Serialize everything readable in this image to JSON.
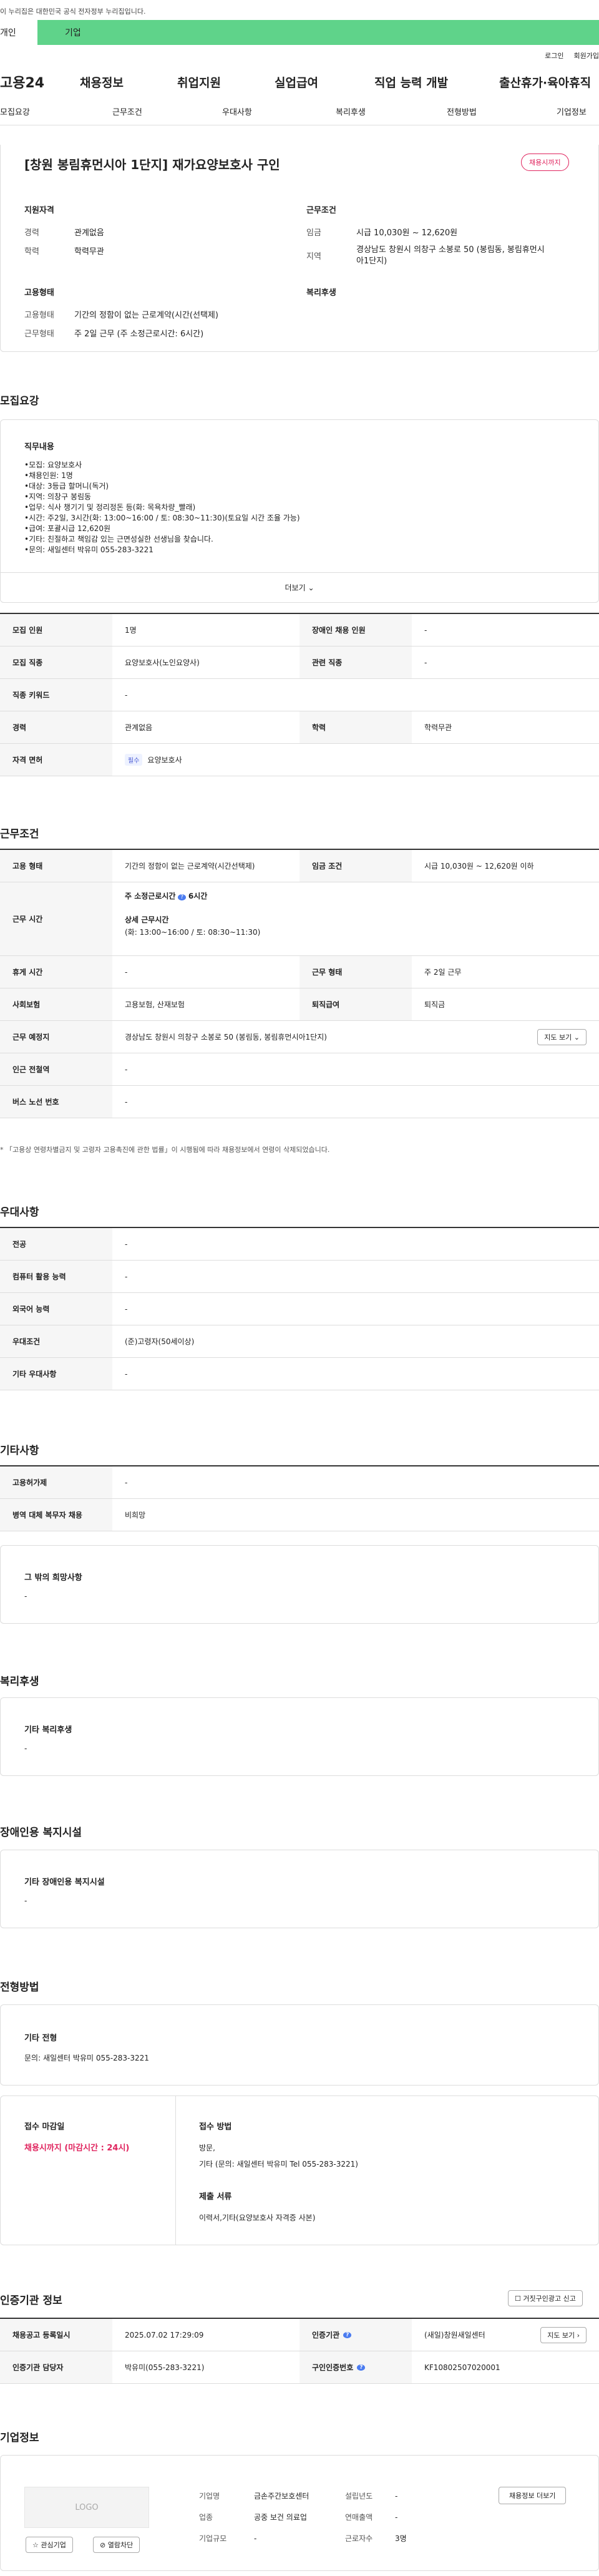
{
  "gov_banner": "이 누리집은 대한민국 공식 전자정부 누리집입니다.",
  "user_tabs": [
    "개인",
    "기업"
  ],
  "toplinks": [
    "로그인",
    "회원가입"
  ],
  "logo": "고용24",
  "gnb": [
    "채용정보",
    "취업지원",
    "실업급여",
    "직업 능력 개발",
    "출산휴가·육아휴직"
  ],
  "subnav": [
    "모집요강",
    "근무조건",
    "우대사항",
    "복리후생",
    "전형방법",
    "기업정보"
  ],
  "title": "[창원 봉림휴먼시아 1단지] 재가요양보호사 구인",
  "status_badge": "채용시까지",
  "summary": {
    "qual_h": "지원자격",
    "exp_l": "경력",
    "exp_v": "관계없음",
    "edu_l": "학력",
    "edu_v": "학력무관",
    "cond_h": "근무조건",
    "wage_l": "임금",
    "wage_v": "시급 10,030원 ~ 12,620원",
    "loc_l": "지역",
    "loc_v1": "경상남도 창원시 의창구 소봉로 50 (봉림동, 봉림휴먼시",
    "loc_v2": "아1단지)",
    "emp_h": "고용형태",
    "type_l": "고용형태",
    "type_v": "기간의 정함이 없는 근로계약(시간(선택제)",
    "hours_l": "근무형태",
    "hours_v": "주 2일 근무 (주 소정근로시간: 6시간)",
    "welfare_h": "복리후생"
  },
  "recruit": {
    "h": "모집요강",
    "duty_h": "직무내용",
    "lines": [
      "•모집: 요양보호사",
      "•채용인원: 1명",
      "•대상: 3등급 할머니(독거)",
      "•지역: 의창구 봉림동",
      "•업무: 식사 챙기기 및 정리정돈 등(화: 목욕차량_빨래)",
      "•시간: 주2일, 3시간(화: 13:00~16:00 / 토: 08:30~11:30)(토요일 시간 조율 가능)",
      "•급여: 포괄시급 12,620원",
      "•기타: 친절하고 책임감 있는 근면성실한 선생님을 찾습니다.",
      "•문의: 새일센터 박유미 055-283-3221"
    ],
    "more": "더보기",
    "rows": [
      [
        "모집 인원",
        "1명",
        "장애인 채용 인원",
        "-"
      ],
      [
        "모집 직종",
        "요양보호사(노인요양사)",
        "관련 직종",
        "-"
      ],
      [
        "직종 키워드",
        "-"
      ],
      [
        "경력",
        "관계없음",
        "학력",
        "학력무관"
      ],
      [
        "자격 면허",
        "요양보호사"
      ]
    ],
    "req": "필수"
  },
  "work": {
    "h": "근무조건",
    "r1": [
      "고용 형태",
      "기간의 정함이 없는 근로계약(시간선택제)",
      "임금 조건",
      "시급 10,030원 ~ 12,620원 이하"
    ],
    "r2k": "근무 시간",
    "r2a": "주 소정근로시간",
    "r2a2": "6시간",
    "r2b": "상세 근무시간",
    "r2c": "(화: 13:00~16:00 / 토: 08:30~11:30)",
    "r3": [
      "휴게 시간",
      "-",
      "근무 형태",
      "주 2일 근무"
    ],
    "r4": [
      "사회보험",
      "고용보험, 산재보험",
      "퇴직급여",
      "퇴직금"
    ],
    "r5": [
      "근무 예정지",
      "경상남도 창원시 의창구 소봉로 50 (봉림동, 봉림휴먼시아1단지)"
    ],
    "map": "지도 보기",
    "r6": [
      "인근 전철역",
      "-"
    ],
    "r7": [
      "버스 노선 번호",
      "-"
    ],
    "note": "* 「고용상 연령차별금지 및 고령자 고용촉진에 관한 법률」이 시행됨에 따라 채용정보에서 연령이 삭제되었습니다."
  },
  "pref": {
    "h": "우대사항",
    "rows": [
      [
        "전공",
        "-"
      ],
      [
        "컴퓨터 활용 능력",
        "-"
      ],
      [
        "외국어 능력",
        "-"
      ],
      [
        "우대조건",
        "(준)고령자(50세이상)"
      ],
      [
        "기타 우대사항",
        "-"
      ]
    ]
  },
  "etc": {
    "h": "기타사항",
    "rows": [
      [
        "고용허가제",
        "-"
      ],
      [
        "병역 대체 복무자 채용",
        "비희망"
      ]
    ],
    "other_h": "그 밖의 희망사항",
    "other_v": "-"
  },
  "welfare": {
    "h": "복리후생",
    "sub": "기타 복리후생",
    "v": "-"
  },
  "disab": {
    "h": "장애인용 복지시설",
    "sub": "기타 장애인용 복지시설",
    "v": "-"
  },
  "screen": {
    "h": "전형방법",
    "sub": "기타 전형",
    "v": "문의: 새일센터 박유미 055-283-3221",
    "deadline_h": "접수 마감일",
    "deadline_v": "채용시까지 (마감시간 : 24시)",
    "method_h": "접수 방법",
    "method_v1": "방문,",
    "method_v2": "기타 (문의: 새일센터 박유미 Tel 055-283-3221)",
    "docs_h": "제출 서류",
    "docs_v": "이력서,기타(요양보호사 자격증 사본)"
  },
  "agency": {
    "h": "인증기관 정보",
    "report": "거짓구인광고 신고",
    "r1": [
      "채용공고 등록일시",
      "2025.07.02 17:29:09",
      "인증기관",
      "(새일)창원새일센터"
    ],
    "r2": [
      "인증기관 담당자",
      "박유미(055-283-3221)",
      "구인인증번호",
      "KF10802507020001"
    ],
    "map": "지도 보기"
  },
  "company": {
    "h": "기업정보",
    "logo": "LOGO",
    "interest": "관심기업",
    "block": "열람차단",
    "f1": [
      "기업명",
      "금손주간보호센터",
      "설립년도",
      "-"
    ],
    "f2": [
      "업종",
      "공중 보건 의료업",
      "연매출액",
      "-"
    ],
    "f3": [
      "기업규모",
      "-",
      "근로자수",
      "3명"
    ],
    "more": "채용정보 더보기"
  }
}
